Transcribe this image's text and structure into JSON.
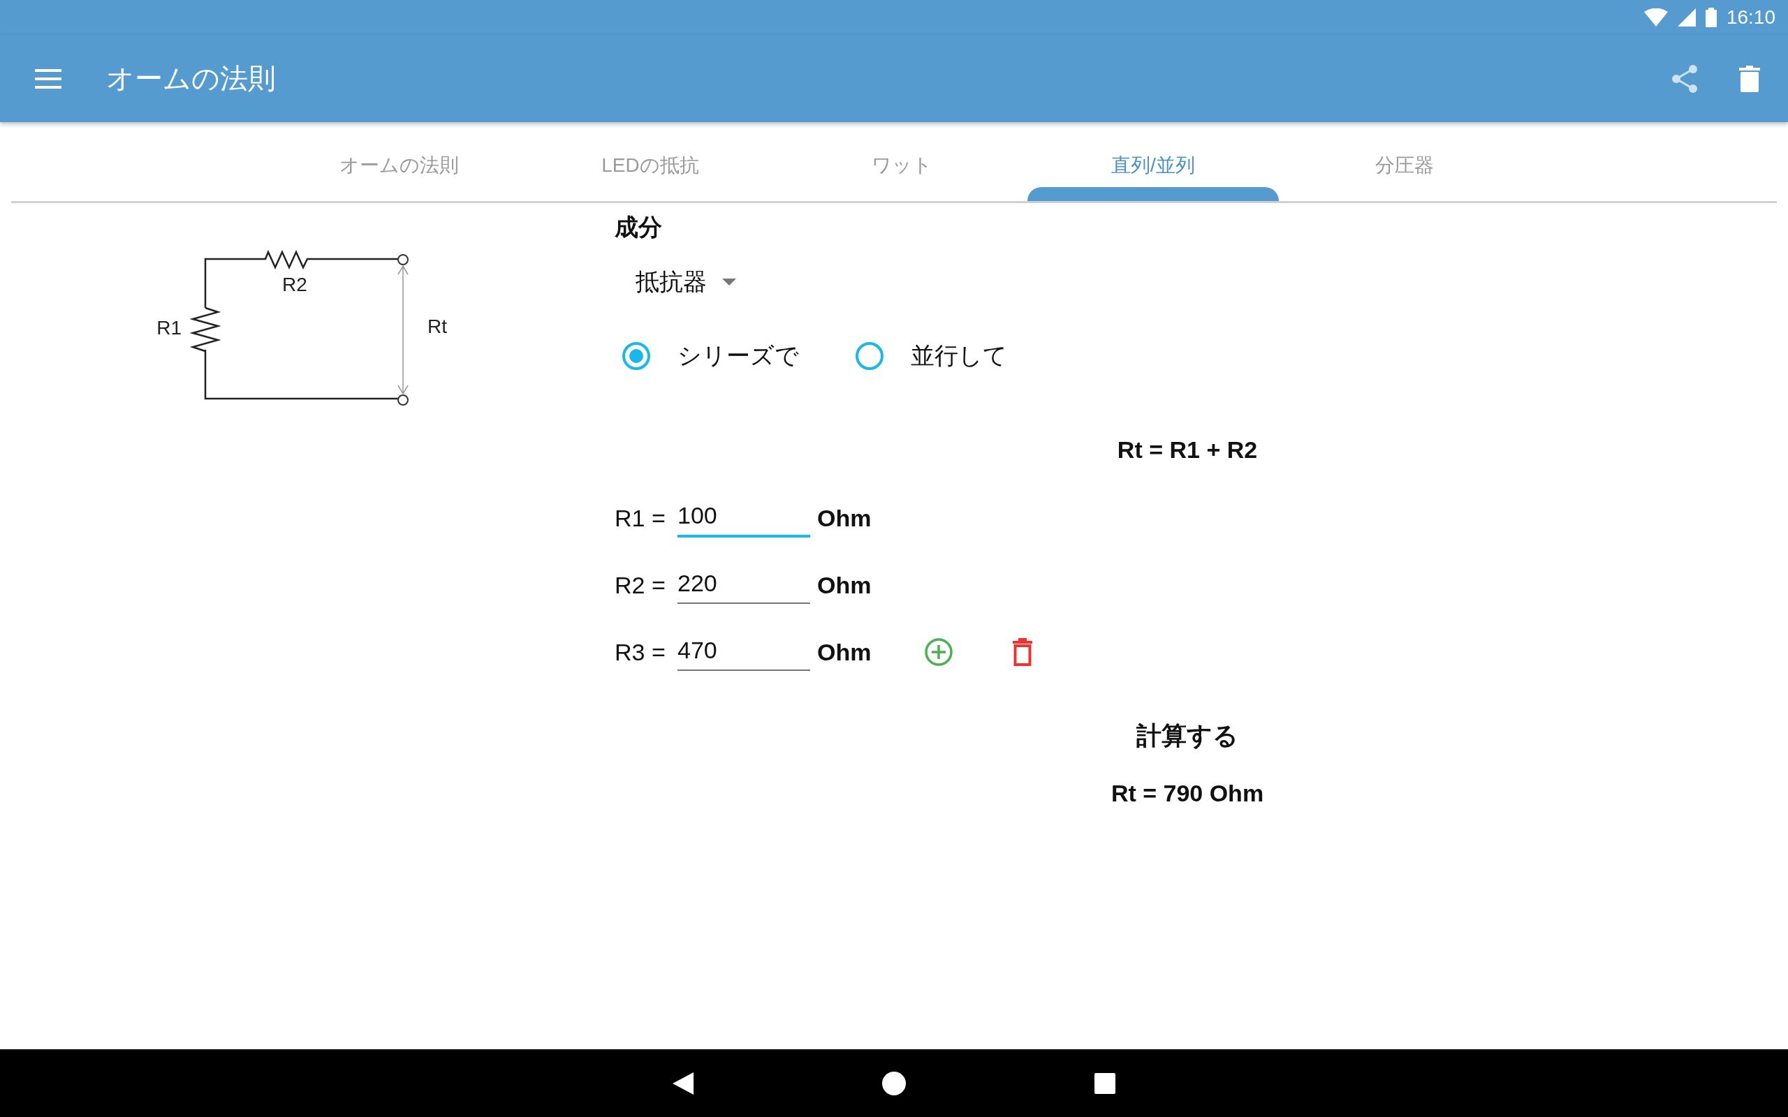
{
  "status_bar": {
    "time": "16:10"
  },
  "app_bar": {
    "title": "オームの法則"
  },
  "tabs": [
    {
      "label": "オームの法則",
      "selected": false
    },
    {
      "label": "LEDの抵抗",
      "selected": false
    },
    {
      "label": "ワット",
      "selected": false
    },
    {
      "label": "直列/並列",
      "selected": true
    },
    {
      "label": "分圧器",
      "selected": false
    }
  ],
  "diagram": {
    "labels": [
      "R2",
      "R1",
      "Rt"
    ]
  },
  "form": {
    "section_title": "成分",
    "component": "抵抗器",
    "radios": [
      {
        "label": "シリーズで",
        "selected": true
      },
      {
        "label": "並行して",
        "selected": false
      }
    ],
    "formula": "Rt = R1 + R2",
    "fields": [
      {
        "label": "R1 =",
        "value": "100",
        "unit": "Ohm",
        "focused": true,
        "actions": false
      },
      {
        "label": "R2 =",
        "value": "220",
        "unit": "Ohm",
        "focused": false,
        "actions": false
      },
      {
        "label": "R3 =",
        "value": "470",
        "unit": "Ohm",
        "focused": false,
        "actions": true
      }
    ],
    "calculate": "計算する",
    "result": "Rt = 790 Ohm"
  }
}
